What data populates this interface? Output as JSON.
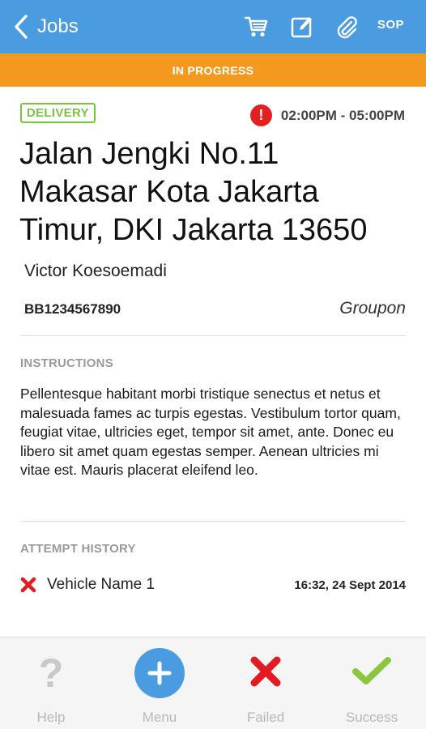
{
  "topbar": {
    "back_label": "Jobs",
    "icons": [
      "cart-icon",
      "edit-icon",
      "paperclip-icon"
    ],
    "sop_label": "SOP"
  },
  "status": {
    "label": "IN PROGRESS"
  },
  "job": {
    "type_badge": "DELIVERY",
    "time_window": "02:00PM - 05:00PM",
    "address_lines": [
      "Jalan Jengki No.11",
      "Makasar Kota Jakarta",
      "Timur, DKI Jakarta 13650"
    ],
    "contact_name": "Victor Koesoemadi",
    "tracking_number": "BB1234567890",
    "merchant": "Groupon"
  },
  "instructions": {
    "title": "INSTRUCTIONS",
    "text": "Pellentesque habitant morbi tristique senectus et netus et malesuada fames ac turpis egestas. Vestibulum tortor quam, feugiat vitae, ultricies eget, tempor sit amet, ante. Donec eu libero sit amet quam egestas semper. Aenean ultricies mi vitae est. Mauris placerat eleifend leo."
  },
  "attempt_history": {
    "title": "ATTEMPT HISTORY",
    "items": [
      {
        "vehicle": "Vehicle Name 1",
        "time": "16:32, 24 Sept 2014",
        "status_icon": "failed-x-icon"
      }
    ]
  },
  "bottombar": {
    "help": "Help",
    "menu": "Menu",
    "failed": "Failed",
    "success": "Success"
  },
  "colors": {
    "primary": "#4a9be0",
    "in_progress": "#f39a1e",
    "delivery_badge": "#7cc242",
    "alert": "#e22020",
    "failed": "#e31b23",
    "success": "#8cc63f"
  }
}
